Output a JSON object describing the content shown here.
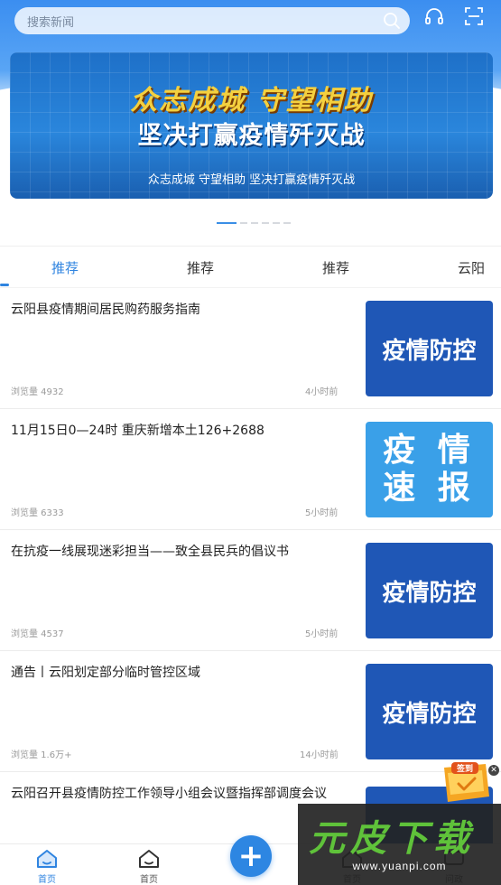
{
  "search": {
    "placeholder": "搜索新闻"
  },
  "header_icons": [
    "headphones-icon",
    "scan-icon"
  ],
  "banner": {
    "line1": "众志成城 守望相助",
    "line2": "坚决打赢疫情歼灭战",
    "caption": "众志成城 守望相助 坚决打赢疫情歼灭战",
    "slide_count": 6,
    "active_slide": 1
  },
  "tabs": [
    {
      "label": "推荐",
      "active": true
    },
    {
      "label": "推荐",
      "active": false
    },
    {
      "label": "推荐",
      "active": false
    },
    {
      "label": "云阳",
      "active": false
    }
  ],
  "news": [
    {
      "title": "云阳县疫情期间居民购药服务指南",
      "views": "浏览量 4932",
      "time": "4小时前",
      "thumb_text": "疫情防控",
      "thumb_style": "dark"
    },
    {
      "title": "11月15日0—24时 重庆新增本土126+2688",
      "views": "浏览量 6333",
      "time": "5小时前",
      "thumb_text": "疫情速报",
      "thumb_line1": "疫 情",
      "thumb_line2": "速 报",
      "thumb_style": "light"
    },
    {
      "title": "在抗疫一线展现迷彩担当——致全县民兵的倡议书",
      "views": "浏览量 4537",
      "time": "5小时前",
      "thumb_text": "疫情防控",
      "thumb_style": "dark"
    },
    {
      "title": "通告丨云阳划定部分临时管控区域",
      "views": "浏览量 1.6万+",
      "time": "14小时前",
      "thumb_text": "疫情防控",
      "thumb_style": "dark"
    },
    {
      "title": "云阳召开县疫情防控工作领导小组会议暨指挥部调度会议",
      "views": "",
      "time": "",
      "thumb_text": "",
      "thumb_style": "dark"
    }
  ],
  "signin": {
    "label": "签到"
  },
  "bottom_nav": [
    {
      "label": "首页",
      "icon": "home-icon",
      "active": true
    },
    {
      "label": "首页",
      "icon": "home-icon",
      "active": false
    },
    {
      "label": "首页",
      "icon": "home-icon",
      "active": false
    },
    {
      "label": "问政",
      "icon": "chat-icon",
      "active": false
    }
  ],
  "plus_button": {
    "symbol": "+"
  },
  "watermark": {
    "text": "元皮下载",
    "url": "www.yuanpi.com"
  },
  "colors": {
    "accent": "#2f84e0",
    "thumb_dark": "#1f57b6",
    "thumb_light": "#3aa0e8",
    "banner_gold": "#f4d03f"
  }
}
